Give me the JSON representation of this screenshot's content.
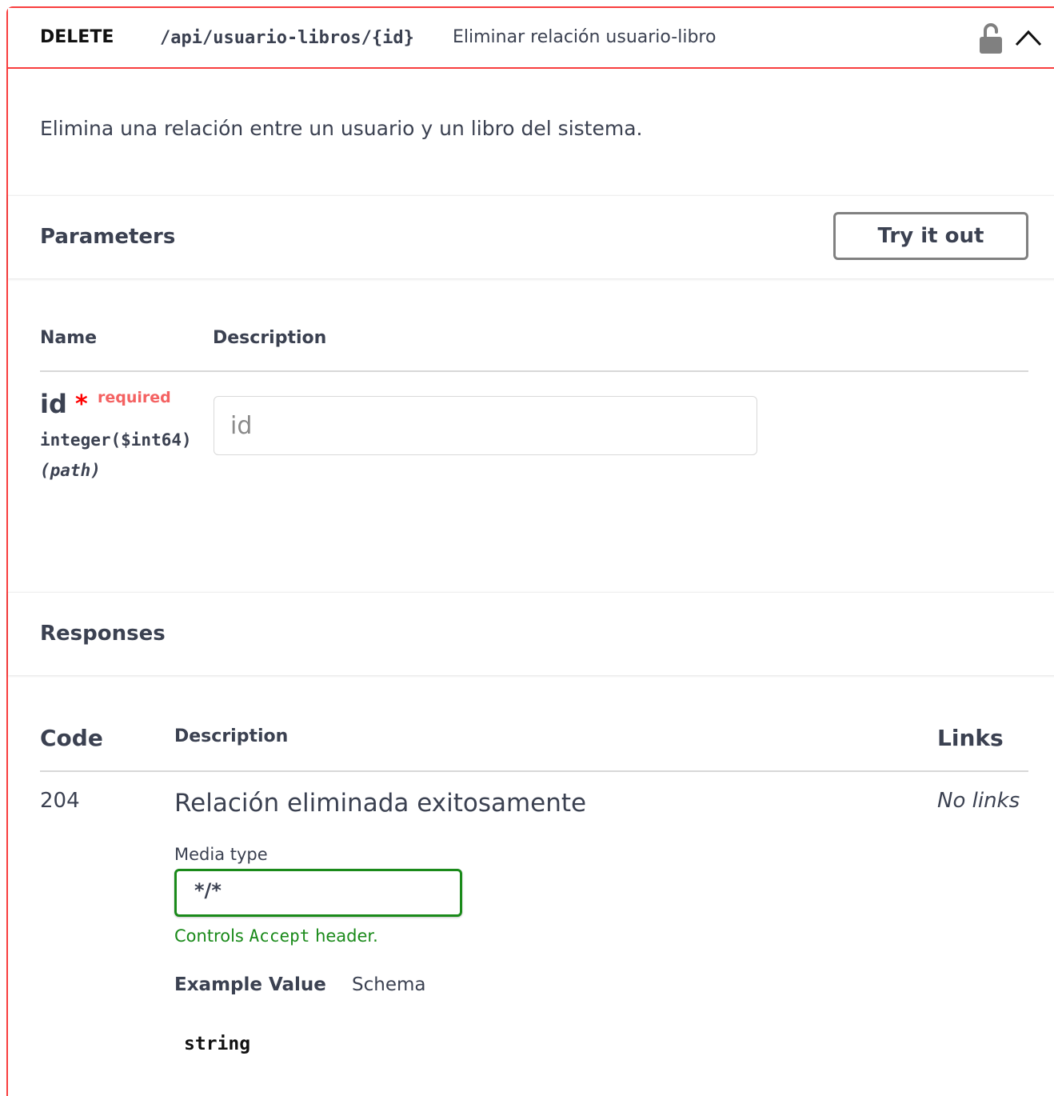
{
  "operation": {
    "method": "DELETE",
    "path": "/api/usuario-libros/{id}",
    "summary": "Eliminar relación usuario-libro",
    "description": "Elimina una relación entre un usuario y un libro del sistema.",
    "colors": {
      "method_border": "#f93e3e",
      "required": "#ff0000",
      "media_select_border": "#1a8a1a"
    },
    "icons": {
      "lock": "lock-open-icon",
      "collapse": "chevron-up-icon"
    }
  },
  "parameters": {
    "title": "Parameters",
    "try_button": "Try it out",
    "col_name": "Name",
    "col_description": "Description",
    "items": [
      {
        "name": "id",
        "required_mark": "*",
        "required_label": "required",
        "type": "integer($int64)",
        "in": "(path)",
        "placeholder": "id",
        "value": ""
      }
    ]
  },
  "responses": {
    "title": "Responses",
    "col_code": "Code",
    "col_description": "Description",
    "col_links": "Links",
    "items": [
      {
        "code": "204",
        "description": "Relación eliminada exitosamente",
        "links": "No links",
        "media_type_label": "Media type",
        "media_type_value": "*/*",
        "media_hint_pre": "Controls ",
        "media_hint_code": "Accept",
        "media_hint_post": " header.",
        "tab_example": "Example Value",
        "tab_schema": "Schema",
        "example": "string"
      }
    ]
  }
}
